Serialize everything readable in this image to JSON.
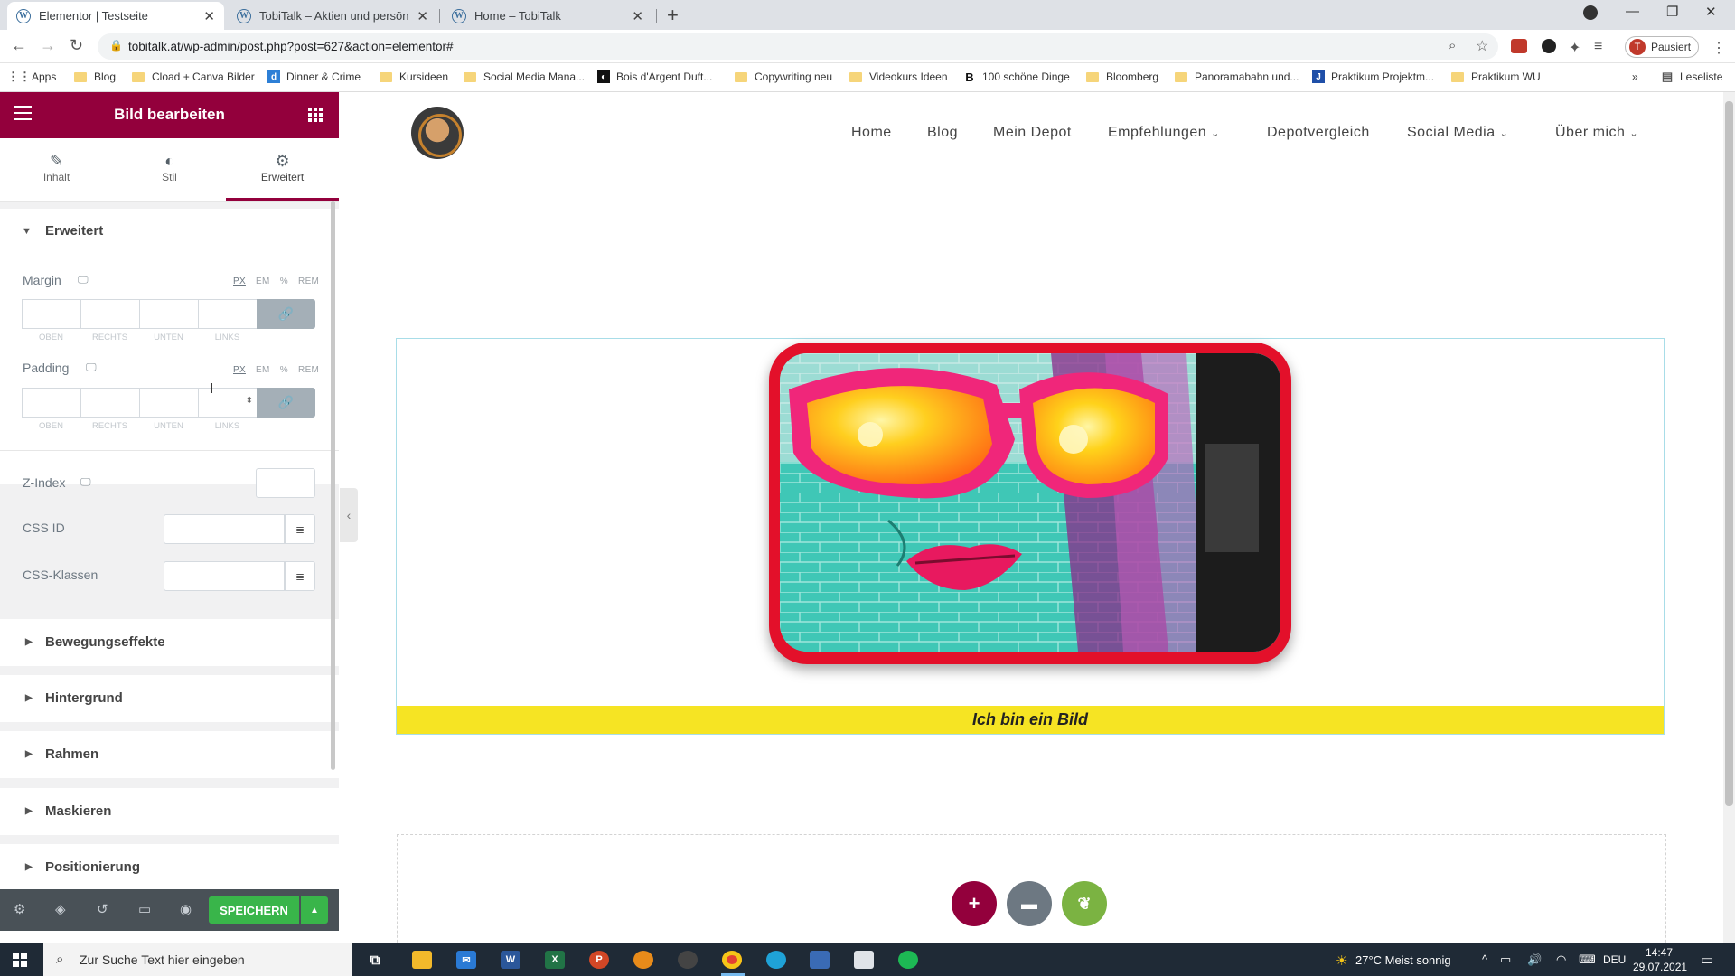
{
  "browser": {
    "tabs": [
      {
        "title": "Elementor | Testseite",
        "active": true
      },
      {
        "title": "TobiTalk – Aktien und persönliche",
        "active": false
      },
      {
        "title": "Home – TobiTalk",
        "active": false
      }
    ],
    "url": "tobitalk.at/wp-admin/post.php?post=627&action=elementor#",
    "profile_label": "Pausiert",
    "profile_initial": "T",
    "bookmarks": [
      {
        "label": "Apps"
      },
      {
        "label": "Blog"
      },
      {
        "label": "Cload + Canva Bilder"
      },
      {
        "label": "Dinner & Crime"
      },
      {
        "label": "Kursideen"
      },
      {
        "label": "Social Media Mana..."
      },
      {
        "label": "Bois d'Argent Duft..."
      },
      {
        "label": "Copywriting neu"
      },
      {
        "label": "Videokurs Ideen"
      },
      {
        "label": "100 schöne Dinge"
      },
      {
        "label": "Bloomberg"
      },
      {
        "label": "Panoramabahn und..."
      },
      {
        "label": "Praktikum Projektm..."
      },
      {
        "label": "Praktikum WU"
      }
    ],
    "reading_list": "Leseliste"
  },
  "panel": {
    "title": "Bild bearbeiten",
    "tabs": [
      {
        "label": "Inhalt",
        "icon": "pencil-icon"
      },
      {
        "label": "Stil",
        "icon": "contrast-icon"
      },
      {
        "label": "Erweitert",
        "icon": "gear-icon"
      }
    ],
    "section_open": "Erweitert",
    "margin": {
      "label": "Margin",
      "units": [
        "PX",
        "EM",
        "%",
        "REM"
      ],
      "active_unit": "PX",
      "sides": [
        "OBEN",
        "RECHTS",
        "UNTEN",
        "LINKS"
      ]
    },
    "padding": {
      "label": "Padding",
      "units": [
        "PX",
        "EM",
        "%",
        "REM"
      ],
      "active_unit": "PX",
      "sides": [
        "OBEN",
        "RECHTS",
        "UNTEN",
        "LINKS"
      ]
    },
    "z_index": {
      "label": "Z-Index",
      "value": ""
    },
    "css_id": {
      "label": "CSS ID",
      "value": ""
    },
    "css_classes": {
      "label": "CSS-Klassen",
      "value": ""
    },
    "sections": [
      "Bewegungseffekte",
      "Hintergrund",
      "Rahmen",
      "Maskieren",
      "Positionierung"
    ],
    "save_label": "SPEICHERN"
  },
  "site": {
    "nav": [
      {
        "label": "Home"
      },
      {
        "label": "Blog"
      },
      {
        "label": "Mein Depot"
      },
      {
        "label": "Empfehlungen",
        "dropdown": true
      },
      {
        "label": "Depotvergleich"
      },
      {
        "label": "Social Media",
        "dropdown": true
      },
      {
        "label": "Über mich",
        "dropdown": true
      }
    ],
    "caption": "Ich bin ein Bild",
    "frame_color": "#e3102a",
    "caption_bg": "#f6e423"
  },
  "taskbar": {
    "search_placeholder": "Zur Suche Text hier eingeben",
    "weather": "27°C  Meist sonnig",
    "lang": "DEU",
    "time": "14:47",
    "date": "29.07.2021"
  },
  "colors": {
    "elementor_primary": "#93003c",
    "save_green": "#39b54a",
    "panel_footer": "#495157"
  }
}
